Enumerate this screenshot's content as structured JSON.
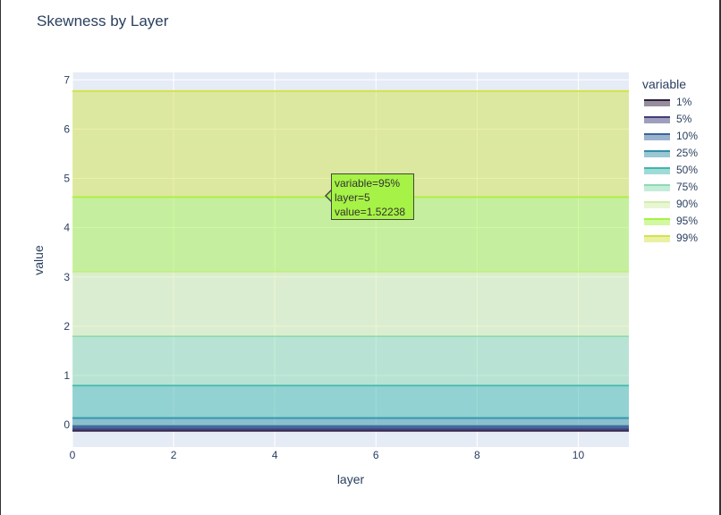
{
  "chart_data": {
    "type": "area",
    "title": "Skewness by Layer",
    "xlabel": "layer",
    "ylabel": "value",
    "xlim": [
      0,
      11
    ],
    "ylim": [
      -0.45,
      7.15
    ],
    "x_ticks": [
      0,
      2,
      4,
      6,
      8,
      10
    ],
    "y_ticks": [
      0,
      1,
      2,
      3,
      4,
      5,
      6,
      7
    ],
    "grid": true,
    "stacked": true,
    "legend_title": "variable",
    "legend_position": "right",
    "x": [
      0,
      1,
      2,
      3,
      4,
      5,
      6,
      7,
      8,
      9,
      10,
      11
    ],
    "series": [
      {
        "name": "1%",
        "color": "#2e1e3b",
        "values": [
          -0.12,
          -0.12,
          -0.12,
          -0.12,
          -0.12,
          -0.12,
          -0.12,
          -0.12,
          -0.12,
          -0.12,
          -0.12,
          -0.12
        ]
      },
      {
        "name": "5%",
        "color": "#413d7b",
        "values": [
          0.04,
          0.04,
          0.04,
          0.04,
          0.04,
          0.04,
          0.04,
          0.04,
          0.04,
          0.04,
          0.04,
          0.04
        ]
      },
      {
        "name": "10%",
        "color": "#37659e",
        "values": [
          0.05,
          0.05,
          0.05,
          0.05,
          0.05,
          0.05,
          0.05,
          0.05,
          0.05,
          0.05,
          0.05,
          0.05
        ]
      },
      {
        "name": "25%",
        "color": "#348fa7",
        "values": [
          0.17,
          0.17,
          0.17,
          0.17,
          0.17,
          0.17,
          0.17,
          0.17,
          0.17,
          0.17,
          0.17,
          0.17
        ]
      },
      {
        "name": "50%",
        "color": "#40b7ad",
        "values": [
          0.66,
          0.66,
          0.66,
          0.66,
          0.66,
          0.66,
          0.66,
          0.66,
          0.66,
          0.66,
          0.66,
          0.66
        ]
      },
      {
        "name": "75%",
        "color": "#8bdab2",
        "values": [
          1.0,
          1.0,
          1.0,
          1.0,
          1.0,
          1.0,
          1.0,
          1.0,
          1.0,
          1.0,
          1.0,
          1.0
        ]
      },
      {
        "name": "90%",
        "color": "#d2eea9",
        "values": [
          1.3,
          1.3,
          1.3,
          1.3,
          1.3,
          1.3,
          1.3,
          1.3,
          1.3,
          1.3,
          1.3,
          1.3
        ]
      },
      {
        "name": "95%",
        "color": "#a6f246",
        "values": [
          1.52238,
          1.52238,
          1.52238,
          1.52238,
          1.52238,
          1.52238,
          1.52238,
          1.52238,
          1.52238,
          1.52238,
          1.52238,
          1.52238
        ]
      },
      {
        "name": "99%",
        "color": "#d4e34a",
        "values": [
          2.15,
          2.15,
          2.15,
          2.15,
          2.15,
          2.15,
          2.15,
          2.15,
          2.15,
          2.15,
          2.15,
          2.15
        ]
      }
    ]
  },
  "hover": {
    "line1": "variable=95%",
    "line2": "layer=5",
    "line3": "value=1.52238"
  }
}
